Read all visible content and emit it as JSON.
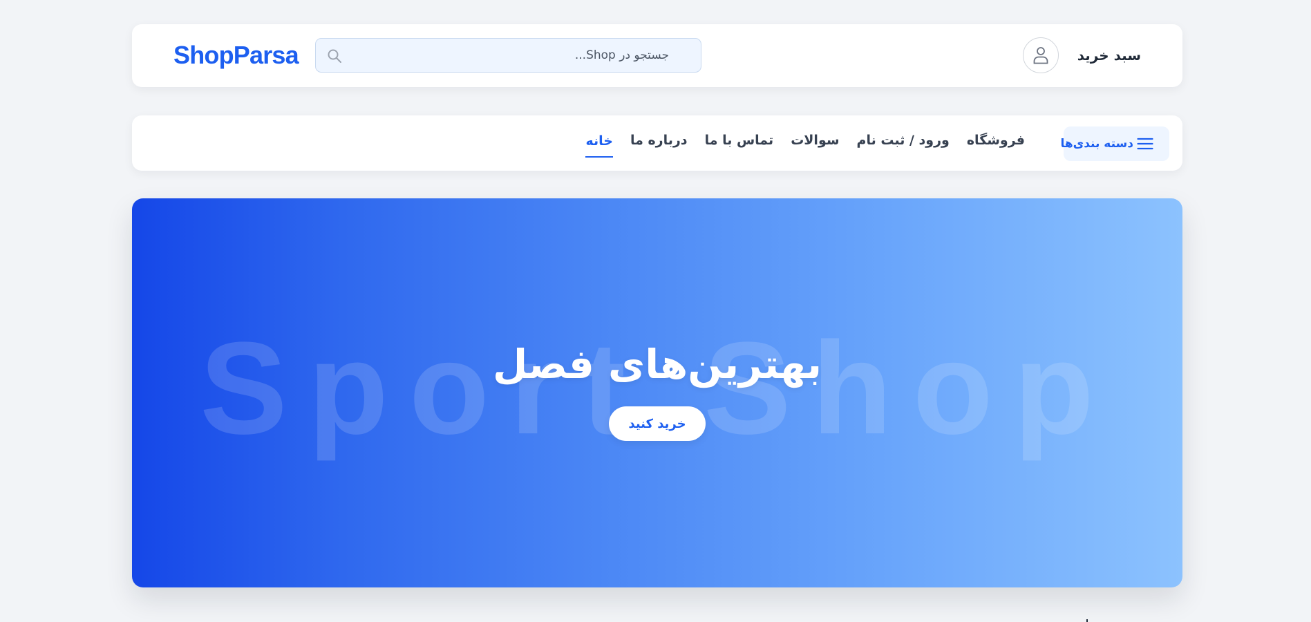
{
  "header": {
    "logo": "ShopParsa",
    "search": {
      "placeholder": "جستجو در Shop...",
      "value": ""
    },
    "user_icon": "user-icon",
    "cart_label": "سبد خرید"
  },
  "nav": {
    "categories_label": "دسته بندی‌ها",
    "categories_icon": "menu-icon",
    "links": [
      {
        "label": "خانه",
        "active": true
      },
      {
        "label": "درباره ما",
        "active": false
      },
      {
        "label": "تماس با ما",
        "active": false
      },
      {
        "label": "سوالات",
        "active": false
      },
      {
        "label": "ورود / ثبت نام",
        "active": false
      },
      {
        "label": "فروشگاه",
        "active": false
      }
    ]
  },
  "hero": {
    "watermark": "Sport Shop",
    "title": "بهترین‌های فصل",
    "button_label": "خرید کنید"
  },
  "colors": {
    "accent": "#1d5ff0",
    "page_background": "#f2f4f7",
    "hero_gradient_start": "#1547e8",
    "hero_gradient_end": "#8cc2fe",
    "search_background": "#eef5ff"
  }
}
